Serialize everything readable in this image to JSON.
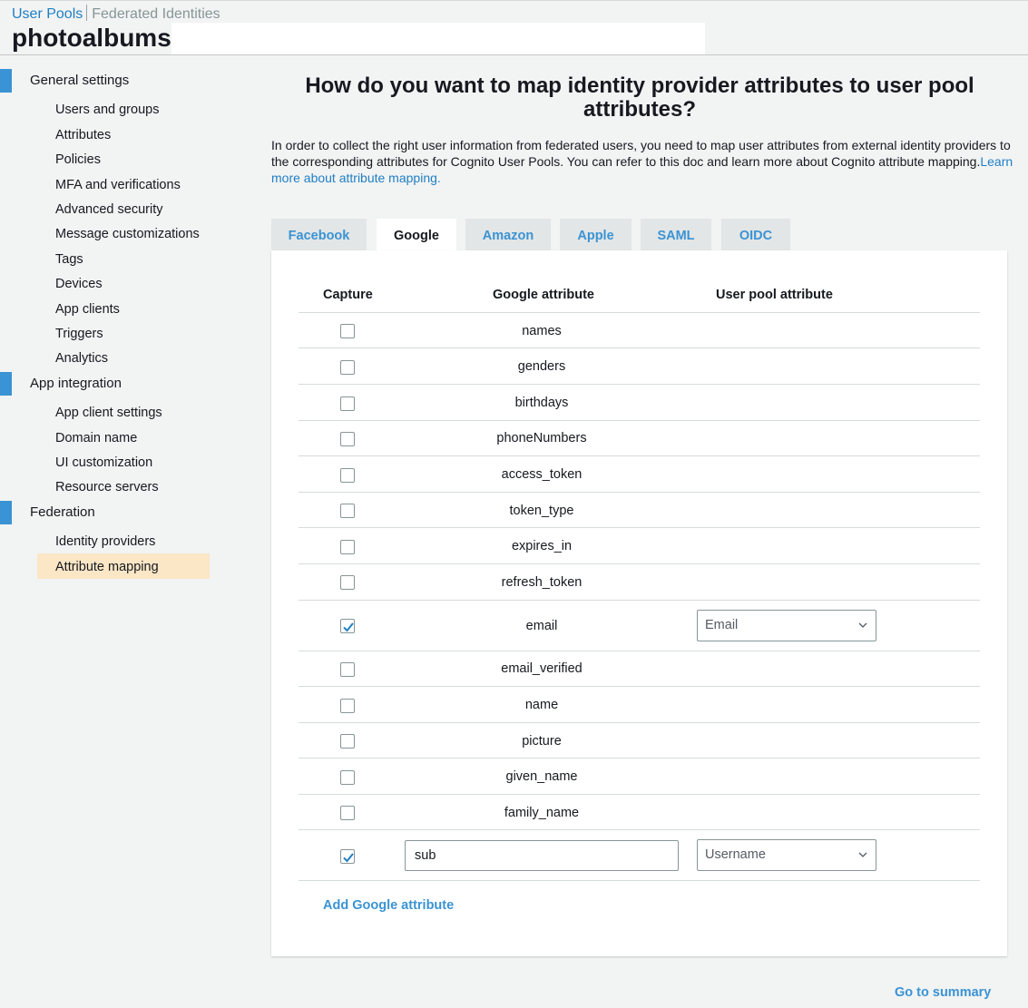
{
  "breadcrumbs": {
    "active": "User Pools",
    "inactive": "Federated Identities"
  },
  "pool_name": "photoalbums",
  "sidebar": {
    "general_settings": {
      "label": "General settings",
      "items": [
        "Users and groups",
        "Attributes",
        "Policies",
        "MFA and verifications",
        "Advanced security",
        "Message customizations",
        "Tags",
        "Devices",
        "App clients",
        "Triggers",
        "Analytics"
      ]
    },
    "app_integration": {
      "label": "App integration",
      "items": [
        "App client settings",
        "Domain name",
        "UI customization",
        "Resource servers"
      ]
    },
    "federation": {
      "label": "Federation",
      "items": [
        "Identity providers",
        "Attribute mapping"
      ],
      "active_item": "Attribute mapping"
    }
  },
  "main": {
    "title": "How do you want to map identity provider attributes to user pool attributes?",
    "intro_text": "In order to collect the right user information from federated users, you need to map user attributes from external identity providers to the corresponding attributes for Cognito User Pools. You can refer to this doc and learn more about Cognito attribute mapping.",
    "intro_link": "Learn more about attribute mapping.",
    "tabs": [
      "Facebook",
      "Google",
      "Amazon",
      "Apple",
      "SAML",
      "OIDC"
    ],
    "selected_tab": "Google",
    "table": {
      "headers": [
        "Capture",
        "Google attribute",
        "User pool attribute"
      ],
      "rows": [
        {
          "attribute": "names",
          "captured": false
        },
        {
          "attribute": "genders",
          "captured": false
        },
        {
          "attribute": "birthdays",
          "captured": false
        },
        {
          "attribute": "phoneNumbers",
          "captured": false
        },
        {
          "attribute": "access_token",
          "captured": false
        },
        {
          "attribute": "token_type",
          "captured": false
        },
        {
          "attribute": "expires_in",
          "captured": false
        },
        {
          "attribute": "refresh_token",
          "captured": false
        },
        {
          "attribute": "email",
          "captured": true,
          "user_pool_attribute": "Email"
        },
        {
          "attribute": "email_verified",
          "captured": false
        },
        {
          "attribute": "name",
          "captured": false
        },
        {
          "attribute": "picture",
          "captured": false
        },
        {
          "attribute": "given_name",
          "captured": false
        },
        {
          "attribute": "family_name",
          "captured": false
        }
      ],
      "custom_row": {
        "attribute_value": "sub",
        "captured": true,
        "user_pool_attribute": "Username"
      }
    },
    "add_attribute_link": "Add Google attribute",
    "go_to_summary_link": "Go to summary"
  },
  "colors": {
    "accent": "#3a93d4",
    "link": "#1f7fc4",
    "active_nav_bg": "#fbe6c6",
    "nav_bar": "#3a93d4"
  }
}
